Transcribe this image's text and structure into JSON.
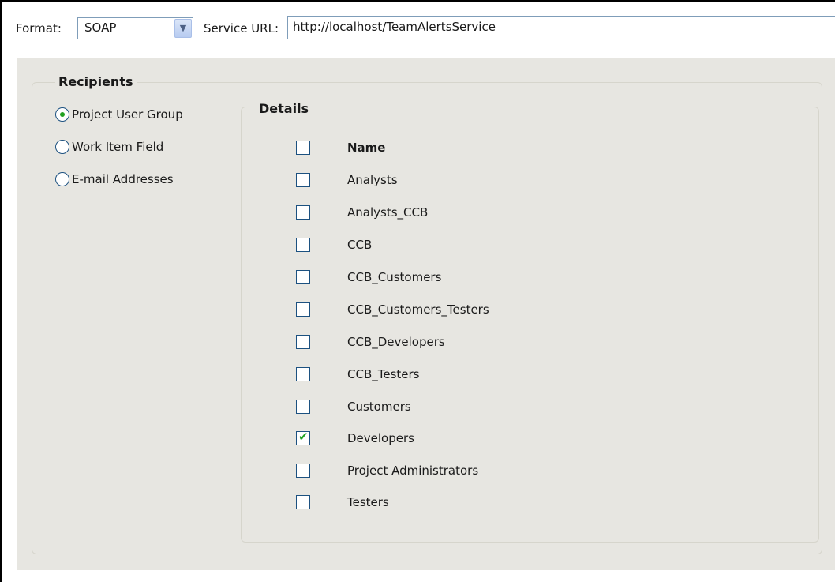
{
  "toolbar": {
    "format_label": "Format:",
    "format_value": "SOAP",
    "service_url_label": "Service URL:",
    "service_url_value": "http://localhost/TeamAlertsService"
  },
  "recipients": {
    "title": "Recipients",
    "options": [
      {
        "label": "Project User Group",
        "selected": true
      },
      {
        "label": "Work Item Field",
        "selected": false
      },
      {
        "label": "E-mail Addresses",
        "selected": false
      }
    ]
  },
  "details": {
    "title": "Details",
    "header_label": "Name",
    "items": [
      {
        "label": "Analysts",
        "checked": false
      },
      {
        "label": "Analysts_CCB",
        "checked": false
      },
      {
        "label": "CCB",
        "checked": false
      },
      {
        "label": "CCB_Customers",
        "checked": false
      },
      {
        "label": "CCB_Customers_Testers",
        "checked": false
      },
      {
        "label": "CCB_Developers",
        "checked": false
      },
      {
        "label": "CCB_Testers",
        "checked": false
      },
      {
        "label": "Customers",
        "checked": false
      },
      {
        "label": "Developers",
        "checked": true
      },
      {
        "label": "Project Administrators",
        "checked": false
      },
      {
        "label": "Testers",
        "checked": false
      }
    ]
  },
  "colors": {
    "panel_bg": "#e7e6e1",
    "control_border": "#1c5180",
    "check_green": "#21a121"
  }
}
